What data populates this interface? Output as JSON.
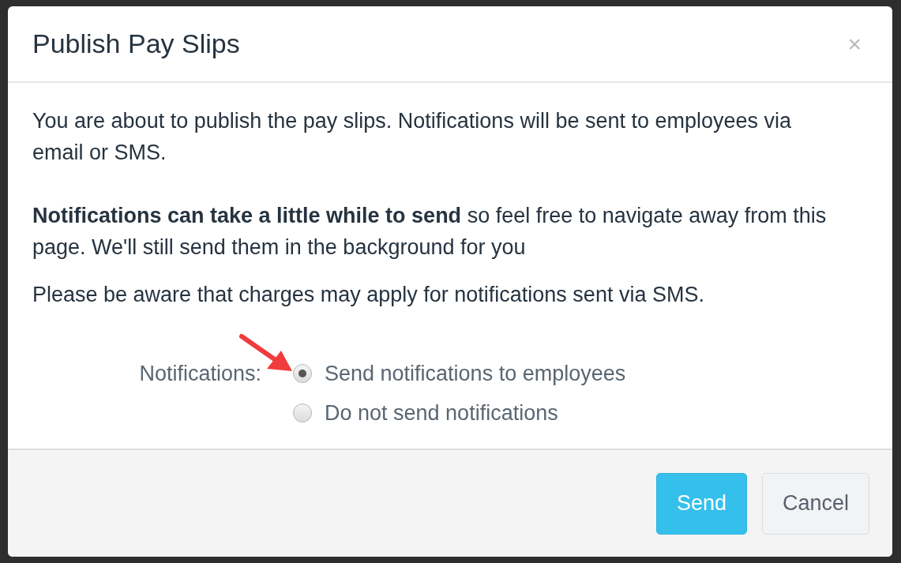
{
  "dialog": {
    "title": "Publish Pay Slips",
    "close": "×",
    "paragraphs": [
      "You are about to publish the pay slips. Notifications will be sent to employees via email or SMS.",
      "**Notifications can take a little while to send** so feel free to navigate away from this page. We'll still send them in the background for you",
      "Please be aware that charges may apply for notifications sent via SMS."
    ],
    "notifications": {
      "label": "Notifications:",
      "options": [
        {
          "label": "Send notifications to employees",
          "selected": true
        },
        {
          "label": "Do not send notifications",
          "selected": false
        }
      ]
    },
    "buttons": [
      {
        "label": "Send",
        "kind": "primary"
      },
      {
        "label": "Cancel",
        "kind": "default"
      }
    ]
  }
}
